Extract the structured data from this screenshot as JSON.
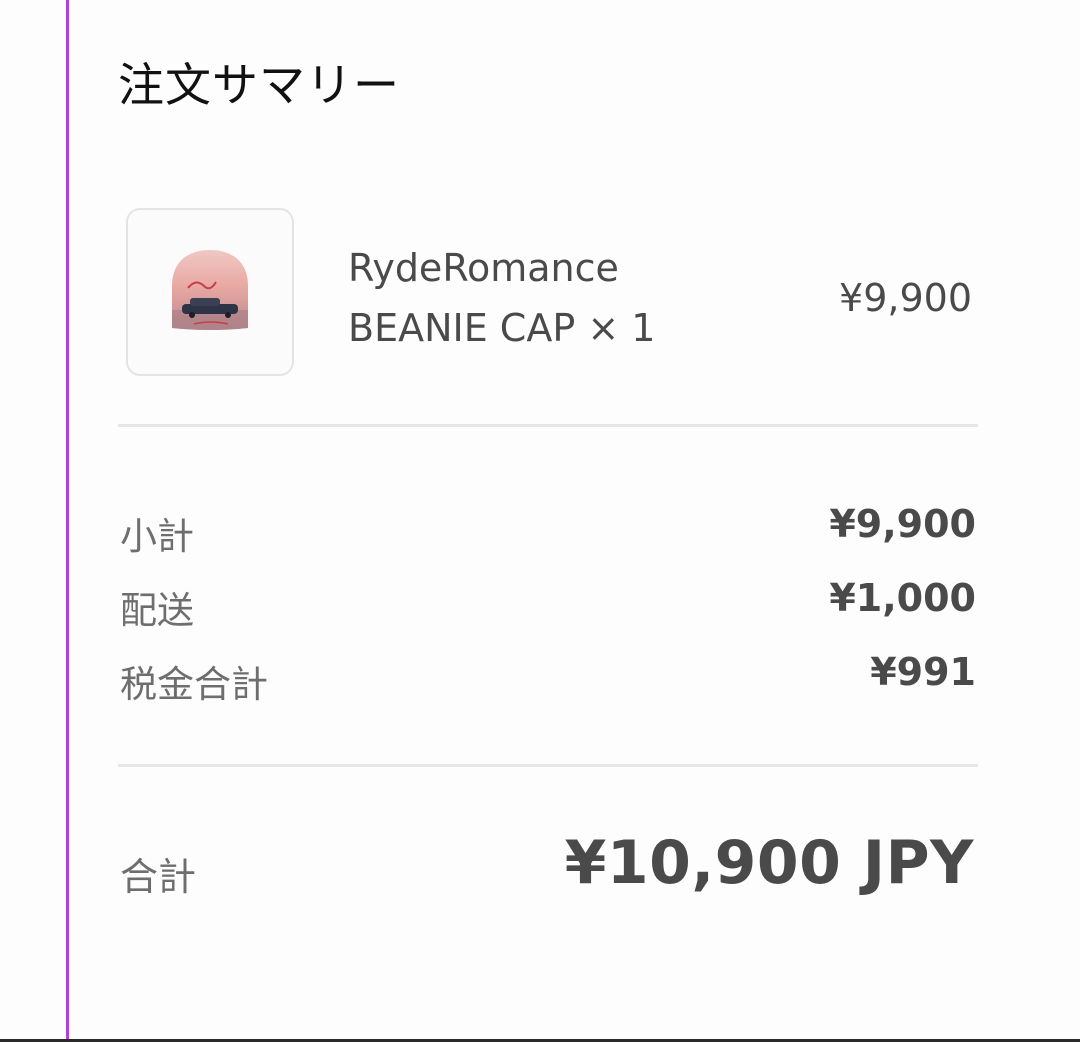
{
  "summary": {
    "title": "注文サマリー"
  },
  "item": {
    "name_line1": "RydeRomance",
    "name_line2": "BEANIE CAP × 1",
    "price": "¥9,900",
    "image_icon": "beanie-cap-product-image"
  },
  "breakdown": {
    "subtotal_label": "小計",
    "subtotal_value": "¥9,900",
    "shipping_label": "配送",
    "shipping_value": "¥1,000",
    "tax_label": "税金合計",
    "tax_value": "¥991"
  },
  "total": {
    "label": "合計",
    "value": "¥10,900 JPY"
  },
  "colors": {
    "accent_rule": "#b040d8",
    "text_primary": "#111111",
    "text_muted": "#6e6e6e",
    "text_value": "#4a4a4a"
  }
}
